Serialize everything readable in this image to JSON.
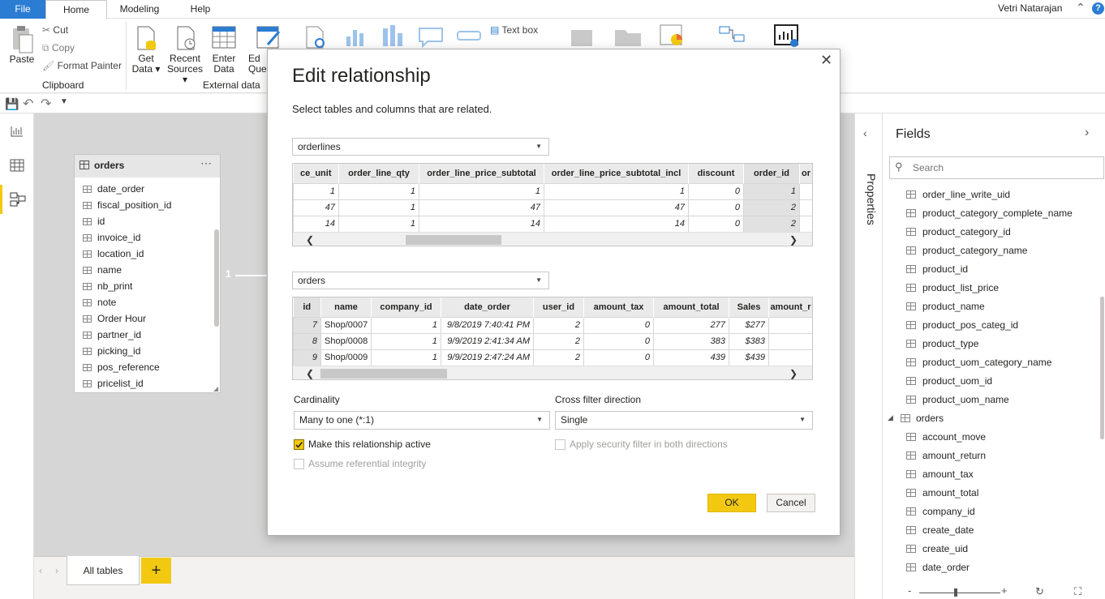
{
  "menu": {
    "file": "File",
    "home": "Home",
    "modeling": "Modeling",
    "help": "Help",
    "user": "Vetri Natarajan"
  },
  "ribbon": {
    "paste": "Paste",
    "cut": "Cut",
    "copy": "Copy",
    "format_painter": "Format Painter",
    "clipboard": "Clipboard",
    "get_data_1": "Get",
    "get_data_2": "Data",
    "recent_sources_1": "Recent",
    "recent_sources_2": "Sources",
    "enter_data_1": "Enter",
    "enter_data_2": "Data",
    "edit_queries_1": "Ed",
    "edit_queries_2": "Que",
    "external_data": "External data",
    "text_box": "Text box"
  },
  "model": {
    "card_title": "orders",
    "card_fields": [
      "date_order",
      "fiscal_position_id",
      "id",
      "invoice_id",
      "location_id",
      "name",
      "nb_print",
      "note",
      "Order Hour",
      "partner_id",
      "picking_id",
      "pos_reference",
      "pricelist_id"
    ],
    "relationship_label": "1",
    "page_tab": "All tables"
  },
  "properties": {
    "label": "Properties"
  },
  "fields_pane": {
    "title": "Fields",
    "search_placeholder": "Search",
    "items": [
      {
        "name": "order_line_write_uid",
        "type": "field"
      },
      {
        "name": "product_category_complete_name",
        "type": "field"
      },
      {
        "name": "product_category_id",
        "type": "field"
      },
      {
        "name": "product_category_name",
        "type": "field"
      },
      {
        "name": "product_id",
        "type": "field"
      },
      {
        "name": "product_list_price",
        "type": "field"
      },
      {
        "name": "product_name",
        "type": "field"
      },
      {
        "name": "product_pos_categ_id",
        "type": "field"
      },
      {
        "name": "product_type",
        "type": "field"
      },
      {
        "name": "product_uom_category_name",
        "type": "field"
      },
      {
        "name": "product_uom_id",
        "type": "field"
      },
      {
        "name": "product_uom_name",
        "type": "field"
      },
      {
        "name": "orders",
        "type": "table"
      },
      {
        "name": "account_move",
        "type": "field"
      },
      {
        "name": "amount_return",
        "type": "field"
      },
      {
        "name": "amount_tax",
        "type": "field"
      },
      {
        "name": "amount_total",
        "type": "field"
      },
      {
        "name": "company_id",
        "type": "field"
      },
      {
        "name": "create_date",
        "type": "field"
      },
      {
        "name": "create_uid",
        "type": "field"
      },
      {
        "name": "date_order",
        "type": "field"
      }
    ]
  },
  "dialog": {
    "title": "Edit relationship",
    "subtitle": "Select tables and columns that are related.",
    "table1": "orderlines",
    "table1_headers": [
      "ce_unit",
      "order_line_qty",
      "order_line_price_subtotal",
      "order_line_price_subtotal_incl",
      "discount",
      "order_id",
      "or"
    ],
    "table1_rows": [
      [
        "1",
        "1",
        "1",
        "1",
        "0",
        "1",
        ""
      ],
      [
        "47",
        "1",
        "47",
        "47",
        "0",
        "2",
        ""
      ],
      [
        "14",
        "1",
        "14",
        "14",
        "0",
        "2",
        ""
      ]
    ],
    "table2": "orders",
    "table2_headers": [
      "id",
      "name",
      "company_id",
      "date_order",
      "user_id",
      "amount_tax",
      "amount_total",
      "Sales",
      "amount_r"
    ],
    "table2_rows": [
      [
        "7",
        "Shop/0007",
        "1",
        "9/8/2019 7:40:41 PM",
        "2",
        "0",
        "277",
        "$277",
        ""
      ],
      [
        "8",
        "Shop/0008",
        "1",
        "9/9/2019 2:41:34 AM",
        "2",
        "0",
        "383",
        "$383",
        ""
      ],
      [
        "9",
        "Shop/0009",
        "1",
        "9/9/2019 2:47:24 AM",
        "2",
        "0",
        "439",
        "$439",
        ""
      ]
    ],
    "cardinality_label": "Cardinality",
    "cardinality_value": "Many to one (*:1)",
    "cross_filter_label": "Cross filter direction",
    "cross_filter_value": "Single",
    "make_active": "Make this relationship active",
    "referential": "Assume referential integrity",
    "security_filter": "Apply security filter in both directions",
    "ok": "OK",
    "cancel": "Cancel"
  }
}
